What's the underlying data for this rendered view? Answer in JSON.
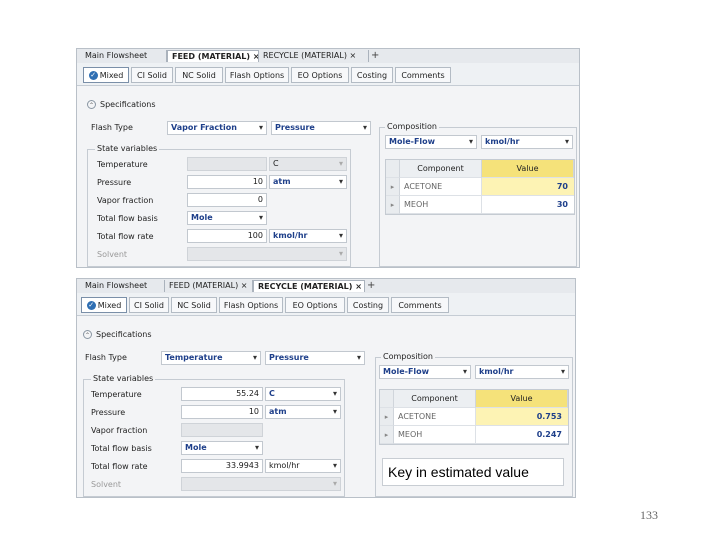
{
  "screenshots": [
    {
      "doc_tabs": [
        "Main Flowsheet",
        "FEED (MATERIAL)",
        "RECYCLE (MATERIAL)"
      ],
      "active_doc_tab": 1,
      "sub_tabs": [
        "Mixed",
        "CI Solid",
        "NC Solid",
        "Flash Options",
        "EO Options",
        "Costing",
        "Comments"
      ],
      "active_sub_tab": 0,
      "specifications_label": "Specifications",
      "flash_type_label": "Flash Type",
      "flash_type_1": "Vapor Fraction",
      "flash_type_2": "Pressure",
      "state_variables_label": "State variables",
      "rows": [
        {
          "label": "Temperature",
          "value": "",
          "unit": "C",
          "value_disabled": true,
          "unit_disabled": true
        },
        {
          "label": "Pressure",
          "value": "10",
          "unit": "atm",
          "value_disabled": false,
          "unit_disabled": false
        },
        {
          "label": "Vapor fraction",
          "value": "0",
          "unit": "",
          "value_disabled": false,
          "unit_disabled": false
        },
        {
          "label": "Total flow basis",
          "value": "Mole",
          "unit": "",
          "value_disabled": false,
          "unit_disabled": false
        },
        {
          "label": "Total flow rate",
          "value": "100",
          "unit": "kmol/hr",
          "value_disabled": false,
          "unit_disabled": false
        },
        {
          "label": "Solvent",
          "value": "",
          "unit": "",
          "value_disabled": true,
          "unit_disabled": false
        }
      ],
      "composition_label": "Composition",
      "comp_basis": "Mole-Flow",
      "comp_unit": "kmol/hr",
      "grid_headers": [
        "Component",
        "Value"
      ],
      "grid_rows": [
        {
          "component": "ACETONE",
          "value": "70"
        },
        {
          "component": "MEOH",
          "value": "30"
        }
      ]
    },
    {
      "doc_tabs": [
        "Main Flowsheet",
        "FEED (MATERIAL)",
        "RECYCLE (MATERIAL)"
      ],
      "active_doc_tab": 2,
      "sub_tabs": [
        "Mixed",
        "CI Solid",
        "NC Solid",
        "Flash Options",
        "EO Options",
        "Costing",
        "Comments"
      ],
      "active_sub_tab": 0,
      "specifications_label": "Specifications",
      "flash_type_label": "Flash Type",
      "flash_type_1": "Temperature",
      "flash_type_2": "Pressure",
      "state_variables_label": "State variables",
      "rows": [
        {
          "label": "Temperature",
          "value": "55.24",
          "unit": "C",
          "value_disabled": false,
          "unit_disabled": false
        },
        {
          "label": "Pressure",
          "value": "10",
          "unit": "atm",
          "value_disabled": false,
          "unit_disabled": false
        },
        {
          "label": "Vapor fraction",
          "value": "",
          "unit": "",
          "value_disabled": true,
          "unit_disabled": false
        },
        {
          "label": "Total flow basis",
          "value": "Mole",
          "unit": "",
          "value_disabled": false,
          "unit_disabled": false
        },
        {
          "label": "Total flow rate",
          "value": "33.9943",
          "unit": "kmol/hr",
          "value_disabled": false,
          "unit_disabled": false
        },
        {
          "label": "Solvent",
          "value": "",
          "unit": "",
          "value_disabled": true,
          "unit_disabled": false
        }
      ],
      "composition_label": "Composition",
      "comp_basis": "Mole-Flow",
      "comp_unit": "kmol/hr",
      "grid_headers": [
        "Component",
        "Value"
      ],
      "grid_rows": [
        {
          "component": "ACETONE",
          "value": "0.753"
        },
        {
          "component": "MEOH",
          "value": "0.247"
        }
      ]
    }
  ],
  "note": "Key in estimated value",
  "page_number": "133"
}
